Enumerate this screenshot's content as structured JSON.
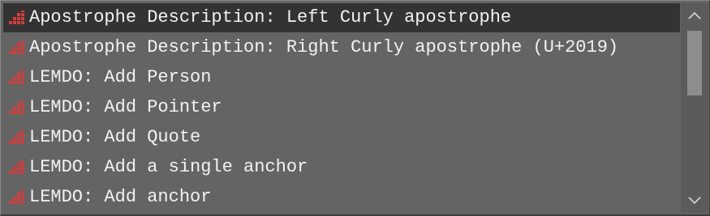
{
  "list": {
    "items": [
      {
        "label": "Apostrophe Description: Left Curly apostrophe",
        "selected": true
      },
      {
        "label": "Apostrophe Description: Right Curly apostrophe (U+2019)",
        "selected": false
      },
      {
        "label": "LEMDO: Add Person",
        "selected": false
      },
      {
        "label": "LEMDO: Add Pointer",
        "selected": false
      },
      {
        "label": "LEMDO: Add Quote",
        "selected": false
      },
      {
        "label": "LEMDO: Add a single anchor",
        "selected": false
      },
      {
        "label": "LEMDO: Add anchor",
        "selected": false
      }
    ],
    "item_icon": "stepped-blocks-icon"
  },
  "scrollbar": {
    "up_icon": "chevron-up-icon",
    "down_icon": "chevron-down-icon",
    "position": 0.0
  },
  "colors": {
    "background": "#646464",
    "selected_row": "#333333",
    "text": "#f2f2f2",
    "icon_red": "#d23c3c",
    "thumb": "#8d8d8d"
  }
}
